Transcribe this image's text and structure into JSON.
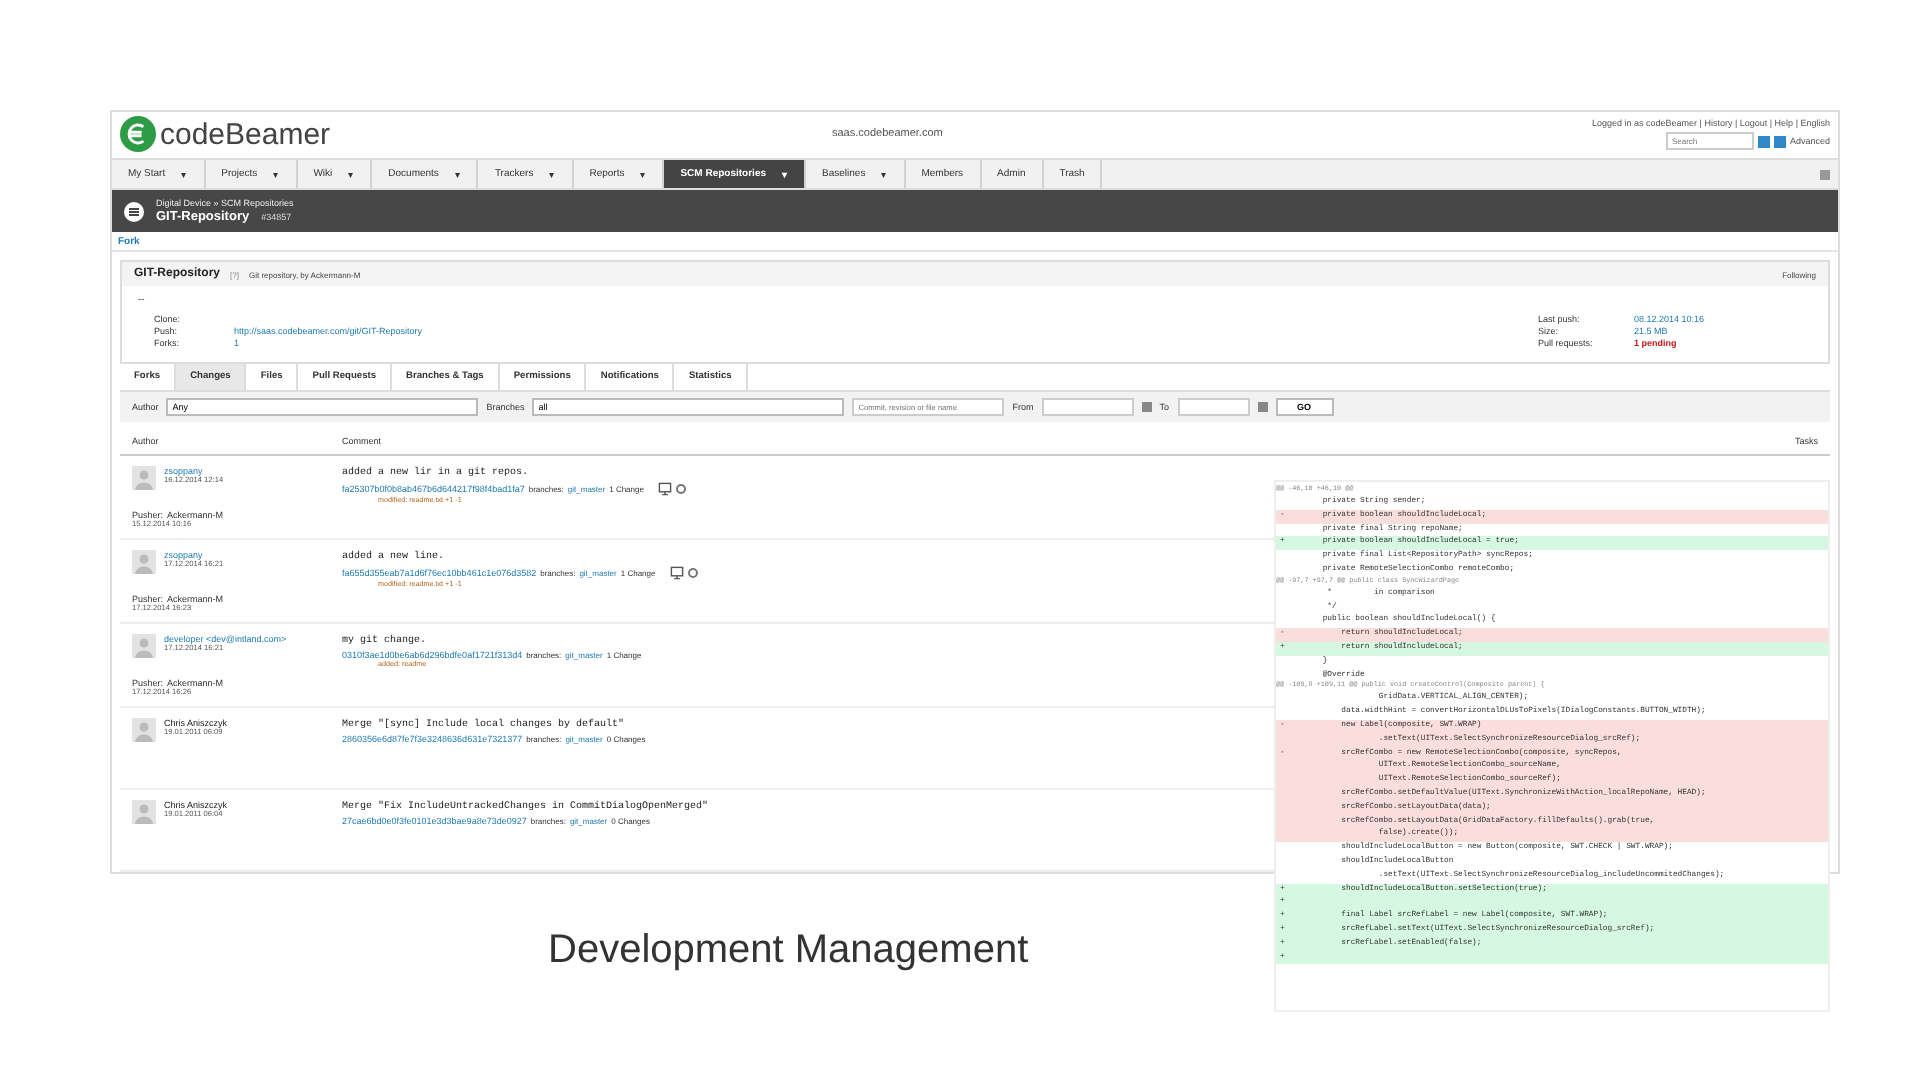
{
  "header": {
    "logo": "codeBeamer",
    "host": "saas.codebeamer.com",
    "user_links": "Logged in as codeBeamer | History | Logout | Help | English",
    "search": {
      "placeholder": "Search"
    },
    "advanced": "Advanced"
  },
  "nav": [
    {
      "label": "My Start",
      "caret": "▾",
      "selected": false
    },
    {
      "label": "Projects",
      "caret": "▾",
      "selected": false
    },
    {
      "label": "Wiki",
      "caret": "▾",
      "selected": false
    },
    {
      "label": "Documents",
      "caret": "▾",
      "selected": false
    },
    {
      "label": "Trackers",
      "caret": "▾",
      "selected": false
    },
    {
      "label": "Reports",
      "caret": "▾",
      "selected": false
    },
    {
      "label": "SCM Repositories",
      "caret": "▾",
      "selected": true
    },
    {
      "label": "Baselines",
      "caret": "▾",
      "selected": false
    },
    {
      "label": "Members",
      "selected": false
    },
    {
      "label": "Admin",
      "selected": false
    },
    {
      "label": "Trash",
      "selected": false
    }
  ],
  "breadcrumb": {
    "path": "Digital Device » SCM Repositories",
    "title": "GIT-Repository",
    "id": "#34857"
  },
  "fork_link": "Fork",
  "repository": {
    "name": "GIT-Repository",
    "help": "[?]",
    "description": "Git repository, by Ackermann-M",
    "following": "Following",
    "dash": "--",
    "left": [
      {
        "label": "Clone:"
      },
      {
        "label": "Push:",
        "value": "http://saas.codebeamer.com/git/GIT-Repository"
      },
      {
        "label": "Forks:",
        "value": "1"
      }
    ],
    "right": [
      {
        "label": "Last push:",
        "value": "08.12.2014 10:16",
        "alert": false
      },
      {
        "label": "Size:",
        "value": "21.5 MB",
        "alert": false
      },
      {
        "label": "Pull requests:",
        "value": "1 pending",
        "alert": true
      }
    ]
  },
  "tabs": [
    {
      "label": "Forks",
      "selected": false
    },
    {
      "label": "Changes",
      "selected": true
    },
    {
      "label": "Files",
      "selected": false
    },
    {
      "label": "Pull Requests",
      "selected": false
    },
    {
      "label": "Branches & Tags",
      "selected": false
    },
    {
      "label": "Permissions",
      "selected": false
    },
    {
      "label": "Notifications",
      "selected": false
    },
    {
      "label": "Statistics",
      "selected": false
    }
  ],
  "filters": {
    "author_label": "Author",
    "author": "Any",
    "branches_label": "Branches",
    "branches": "all",
    "search": {
      "placeholder": "Commit, revision or file name"
    },
    "from_label": "From",
    "to_label": "To",
    "go": "GO"
  },
  "table": {
    "columns": [
      "Author",
      "Comment",
      "Tasks"
    ],
    "rows": [
      {
        "author": "zsoppany",
        "date": "16.12.2014 12:14",
        "message": "added a new lir in a git repos.",
        "hash": "fa25307b0f0b8ab467b6d644217f98f4bad1fa7",
        "branches_label": "branches:",
        "branch": "git_master",
        "changes": "1 Change",
        "icons": true,
        "file": "modified: readme.txt +1 -1",
        "pusher_label": "Pusher:",
        "pusher": "Ackermann-M",
        "pushed": "15.12.2014 10:16"
      },
      {
        "author": "zsoppany",
        "date": "17.12.2014 16:21",
        "message": "added a new line.",
        "hash": "fa655d355eab7a1d6f76ec10bb461c1e076d3582",
        "branches_label": "branches:",
        "branch": "git_master",
        "changes": "1 Change",
        "icons": true,
        "file": "modified: readme.txt +1 -1",
        "pusher_label": "Pusher:",
        "pusher": "Ackermann-M",
        "pushed": "17.12.2014 16:23"
      },
      {
        "author": "developer <dev@intland.com>",
        "date": "17.12.2014 16:21",
        "message": "my git change.",
        "hash": "0310f3ae1d0be6ab6d296bdfe0af1721f313d4",
        "branches_label": "branches:",
        "branch": "git_master",
        "changes": "1 Change",
        "icons": false,
        "file": "added: readme",
        "pusher_label": "Pusher:",
        "pusher": "Ackermann-M",
        "pushed": "17.12.2014 16:26"
      },
      {
        "author": "Chris Aniszczyk",
        "date": "19.01.2011 06:09",
        "message": "Merge \"[sync] Include local changes by default\"",
        "hash": "2860356e6d87fe7f3e3248636d631e7321377",
        "branches_label": "branches:",
        "branch": "git_master",
        "changes": "0 Changes",
        "icons": false
      },
      {
        "author": "Chris Aniszczyk",
        "date": "19.01.2011 06:04",
        "message": "Merge \"Fix IncludeUntrackedChanges in CommitDialogOpenMerged\"",
        "hash": "27cae6bd0e0f3fe0101e3d3bae9a8e73de0927",
        "branches_label": "branches:",
        "branch": "git_master",
        "changes": "0 Changes",
        "icons": false
      }
    ]
  },
  "diff": [
    {
      "kind": "hunk",
      "text": "@@ -46,10 +46,10 @@"
    },
    {
      "kind": "ctx",
      "text": "    private String sender;"
    },
    {
      "kind": "del",
      "sign": "-",
      "text": "    private boolean shouldIncludeLocal;"
    },
    {
      "kind": "ctx",
      "text": "    private final String repoName;"
    },
    {
      "kind": "add",
      "sign": "+",
      "text": "    private boolean shouldIncludeLocal = true;"
    },
    {
      "kind": "ctx",
      "text": "    private final List<RepositoryPath> syncRepos;"
    },
    {
      "kind": "ctx",
      "text": "    private RemoteSelectionCombo remoteCombo;"
    },
    {
      "kind": "hunk",
      "text": "@@ -97,7 +97,7 @@ public class SyncWizardPage"
    },
    {
      "kind": "ctx",
      "text": "     *         in comparison"
    },
    {
      "kind": "ctx",
      "text": "     */"
    },
    {
      "kind": "ctx",
      "text": "    public boolean shouldIncludeLocal() {"
    },
    {
      "kind": "del",
      "sign": "-",
      "text": "        return shouldIncludeLocal;"
    },
    {
      "kind": "add",
      "sign": "+",
      "text": "        return shouldIncludeLocal;"
    },
    {
      "kind": "ctx",
      "text": "    }"
    },
    {
      "kind": "ctx",
      "text": "    @Override"
    },
    {
      "kind": "hunk",
      "text": "@@ -109,8 +109,11 @@ public void createControl(Composite parent) {"
    },
    {
      "kind": "ctx",
      "text": "                GridData.VERTICAL_ALIGN_CENTER);"
    },
    {
      "kind": "ctx",
      "text": "        data.widthHint = convertHorizontalDLUsToPixels(IDialogConstants.BUTTON_WIDTH);"
    },
    {
      "kind": "del",
      "sign": "-",
      "text": "        new Label(composite, SWT.WRAP)"
    },
    {
      "kind": "del",
      "text": "                .setText(UIText.SelectSynchronizeResourceDialog_srcRef);"
    },
    {
      "kind": "del",
      "sign": "-",
      "text": "        srcRefCombo = new RemoteSelectionCombo(composite, syncRepos,"
    },
    {
      "kind": "del",
      "text": "                UIText.RemoteSelectionCombo_sourceName,"
    },
    {
      "kind": "del",
      "text": "                UIText.RemoteSelectionCombo_sourceRef);"
    },
    {
      "kind": "del",
      "text": "        srcRefCombo.setDefaultValue(UIText.SynchronizeWithAction_localRepoName, HEAD);"
    },
    {
      "kind": "del",
      "text": "        srcRefCombo.setLayoutData(data);"
    },
    {
      "kind": "del",
      "text": "        srcRefCombo.setLayoutData(GridDataFactory.fillDefaults().grab(true,"
    },
    {
      "kind": "del",
      "text": "                false).create());"
    },
    {
      "kind": "ctx",
      "text": "        shouldIncludeLocalButton = new Button(composite, SWT.CHECK | SWT.WRAP);"
    },
    {
      "kind": "ctx",
      "text": "        shouldIncludeLocalButton"
    },
    {
      "kind": "ctx",
      "text": "                .setText(UIText.SelectSynchronizeResourceDialog_includeUncommitedChanges);"
    },
    {
      "kind": "add",
      "sign": "+",
      "text": "        shouldIncludeLocalButton.setSelection(true);"
    },
    {
      "kind": "add",
      "sign": "+"
    },
    {
      "kind": "add",
      "sign": "+",
      "text": "        final Label srcRefLabel = new Label(composite, SWT.WRAP);"
    },
    {
      "kind": "add",
      "sign": "+",
      "text": "        srcRefLabel.setText(UIText.SelectSynchronizeResourceDialog_srcRef);"
    },
    {
      "kind": "add",
      "sign": "+",
      "text": "        srcRefLabel.setEnabled(false);"
    },
    {
      "kind": "add",
      "sign": "+"
    }
  ],
  "caption": "Development Management"
}
